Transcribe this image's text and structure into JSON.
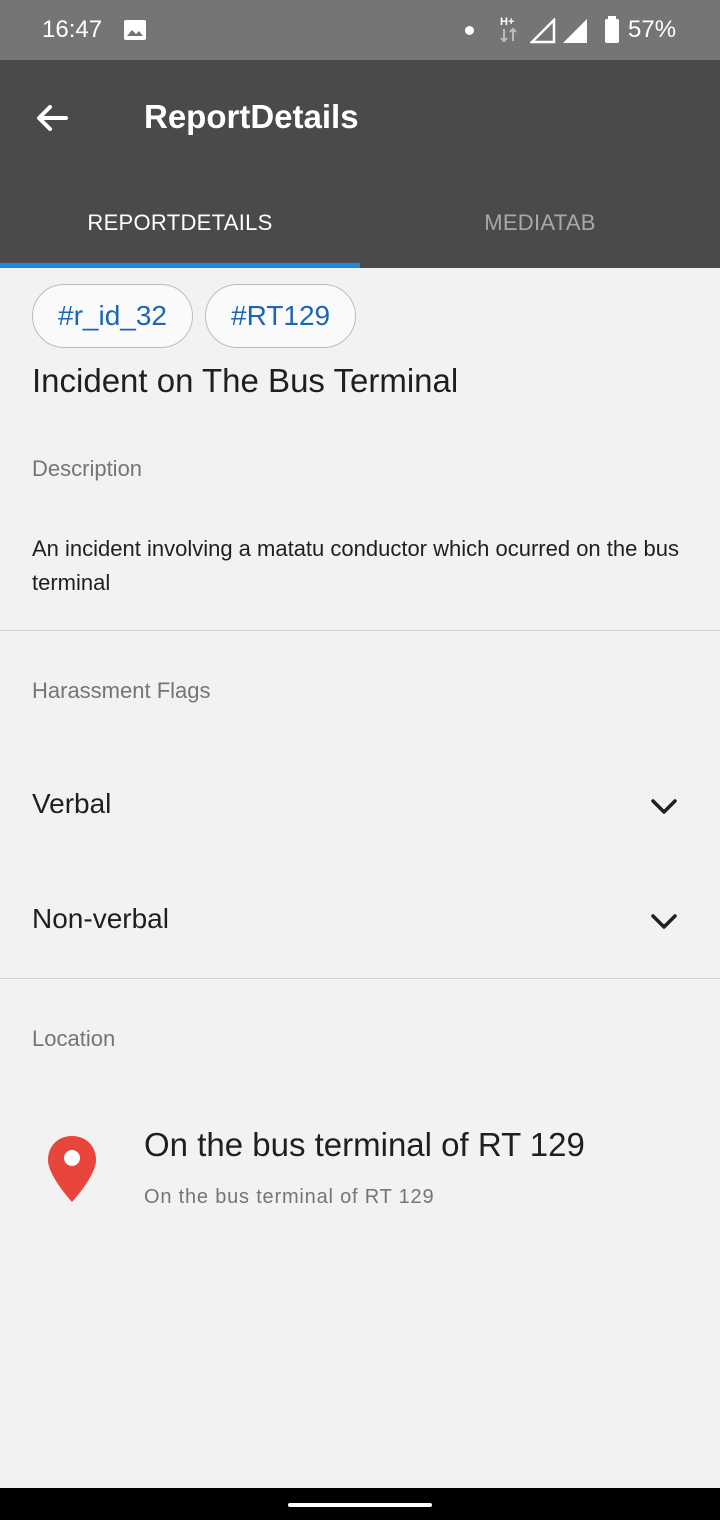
{
  "status_bar": {
    "time": "16:47",
    "battery_percent": "57%",
    "icons": [
      "image-icon",
      "notification-dot-icon",
      "hplus-network-icon",
      "signal-icon",
      "signal-icon",
      "battery-icon"
    ]
  },
  "app_bar": {
    "title": "ReportDetails",
    "back_icon": "arrow-left-icon",
    "tabs": [
      {
        "label": "REPORTDETAILS",
        "selected": true
      },
      {
        "label": "MEDIATAB",
        "selected": false
      }
    ],
    "accent_color": "#1e88e5"
  },
  "report": {
    "chips": [
      "#r_id_32",
      "#RT129"
    ],
    "title": "Incident on The Bus Terminal",
    "description_label": "Description",
    "description": "An incident involving a matatu conductor which ocurred on the bus terminal",
    "flags_label": "Harassment Flags",
    "flags": [
      {
        "label": "Verbal",
        "icon": "chevron-down-icon"
      },
      {
        "label": "Non-verbal",
        "icon": "chevron-down-icon"
      }
    ],
    "location_label": "Location",
    "location": {
      "icon": "location-pin-icon",
      "icon_color": "#e8453c",
      "title": "On the bus terminal of RT 129",
      "subtitle": "On the bus terminal of RT 129"
    }
  }
}
